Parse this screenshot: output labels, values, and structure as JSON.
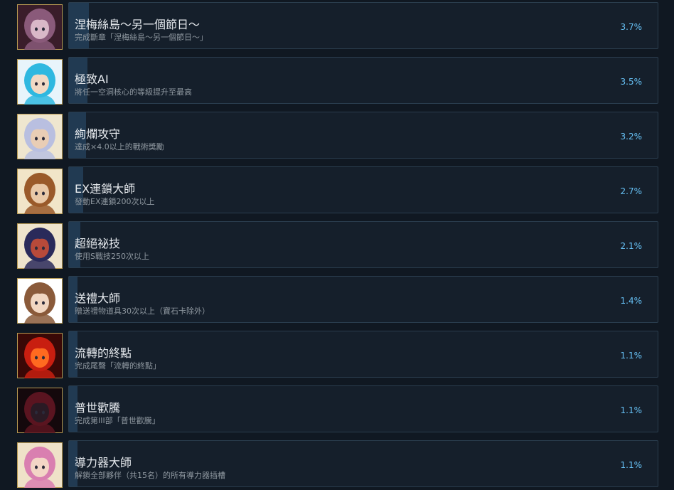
{
  "achievements": [
    {
      "title": "涅梅絲島～另一個節日～",
      "desc": "完成斷章「涅梅絲島～另一個節日～」",
      "percent": "3.7%",
      "fraction": 0.037,
      "icon": "purple-haired-girl-portrait-icon",
      "colors": [
        "#3a1d2a",
        "#8a5a7a",
        "#d9b8c8"
      ]
    },
    {
      "title": "極致AI",
      "desc": "將任一空洞核心的等級提升至最高",
      "percent": "3.5%",
      "fraction": 0.035,
      "icon": "cyan-haired-ai-girl-portrait-icon",
      "colors": [
        "#e8f4fb",
        "#2fb8e0",
        "#f1d9c4"
      ]
    },
    {
      "title": "絢爛攻守",
      "desc": "達成×4.0以上的戰術獎勵",
      "percent": "3.2%",
      "fraction": 0.032,
      "icon": "silver-haired-boy-portrait-icon",
      "colors": [
        "#efe6cf",
        "#b9bfe0",
        "#e9cdb5"
      ]
    },
    {
      "title": "EX連鎖大師",
      "desc": "發動EX連鎖200次以上",
      "percent": "2.7%",
      "fraction": 0.027,
      "icon": "glasses-man-portrait-icon",
      "colors": [
        "#f1e5c8",
        "#9a5a2a",
        "#e9c9a8"
      ]
    },
    {
      "title": "超絕祕技",
      "desc": "使用S戰技250次以上",
      "percent": "2.1%",
      "fraction": 0.021,
      "icon": "red-haired-warrior-portrait-icon",
      "colors": [
        "#efe4cc",
        "#2a2a5a",
        "#b84a3a"
      ]
    },
    {
      "title": "送禮大師",
      "desc": "贈送禮物道具30次以上（寶石卡除外）",
      "percent": "1.4%",
      "fraction": 0.014,
      "icon": "maid-girl-portrait-icon",
      "colors": [
        "#ffffff",
        "#8a5a3a",
        "#f1d7c2"
      ]
    },
    {
      "title": "流轉的終點",
      "desc": "完成尾聲「流轉的終點」",
      "percent": "1.1%",
      "fraction": 0.011,
      "icon": "red-demon-portrait-icon",
      "colors": [
        "#3a0806",
        "#c81e10",
        "#ff6a20"
      ]
    },
    {
      "title": "普世歡騰",
      "desc": "完成第III部「普世歡騰」",
      "percent": "1.1%",
      "fraction": 0.011,
      "icon": "dark-armored-figure-portrait-icon",
      "colors": [
        "#14080c",
        "#5a1420",
        "#2a1a24"
      ]
    },
    {
      "title": "導力器大師",
      "desc": "解鎖全部夥伴（共15名）的所有導力器插槽",
      "percent": "1.1%",
      "fraction": 0.011,
      "icon": "pink-haired-girl-portrait-icon",
      "colors": [
        "#efe2c8",
        "#d97fb0",
        "#f3d6c6"
      ]
    }
  ]
}
